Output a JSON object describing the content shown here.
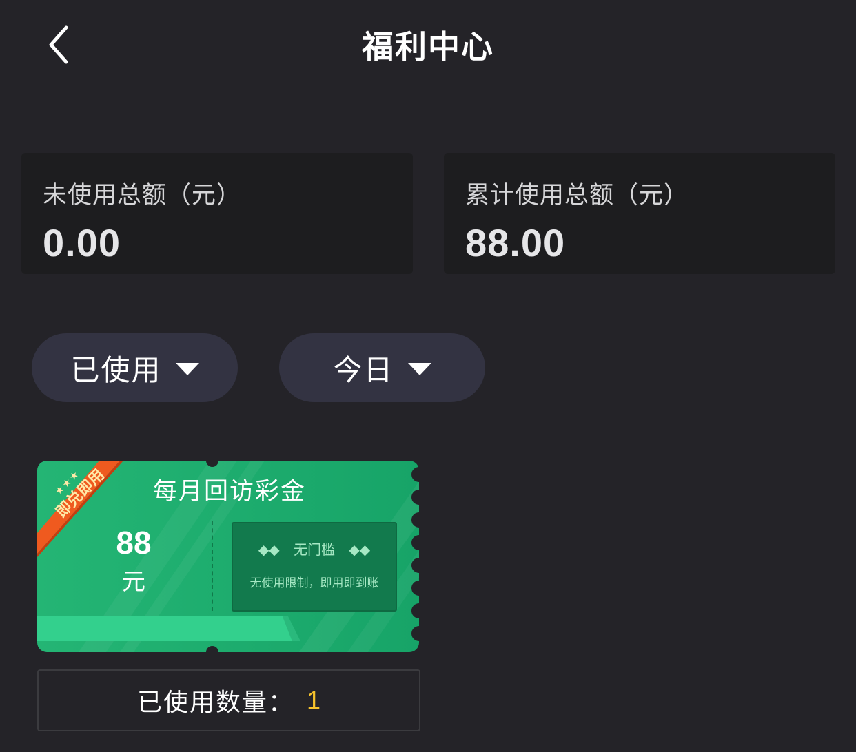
{
  "header": {
    "title": "福利中心",
    "back_icon": "chevron-left-icon"
  },
  "stats": {
    "unused_label": "未使用总额（元）",
    "unused_value": "0.00",
    "used_label": "累计使用总额（元）",
    "used_value": "88.00"
  },
  "filters": {
    "status_label": "已使用",
    "date_label": "今日",
    "caret_icon": "caret-down-icon"
  },
  "coupon": {
    "ribbon_label": "即兑即用",
    "ribbon_stars": "★★★",
    "title": "每月回访彩金",
    "amount": "88",
    "unit": "元",
    "badge": "无门槛",
    "description": "无使用限制，即用即到账",
    "colors": {
      "green": "#1aa66a",
      "ribbon": "#f25a1d"
    }
  },
  "usage": {
    "label": "已使用数量：",
    "value": "1",
    "value_color": "#f6c22c"
  }
}
